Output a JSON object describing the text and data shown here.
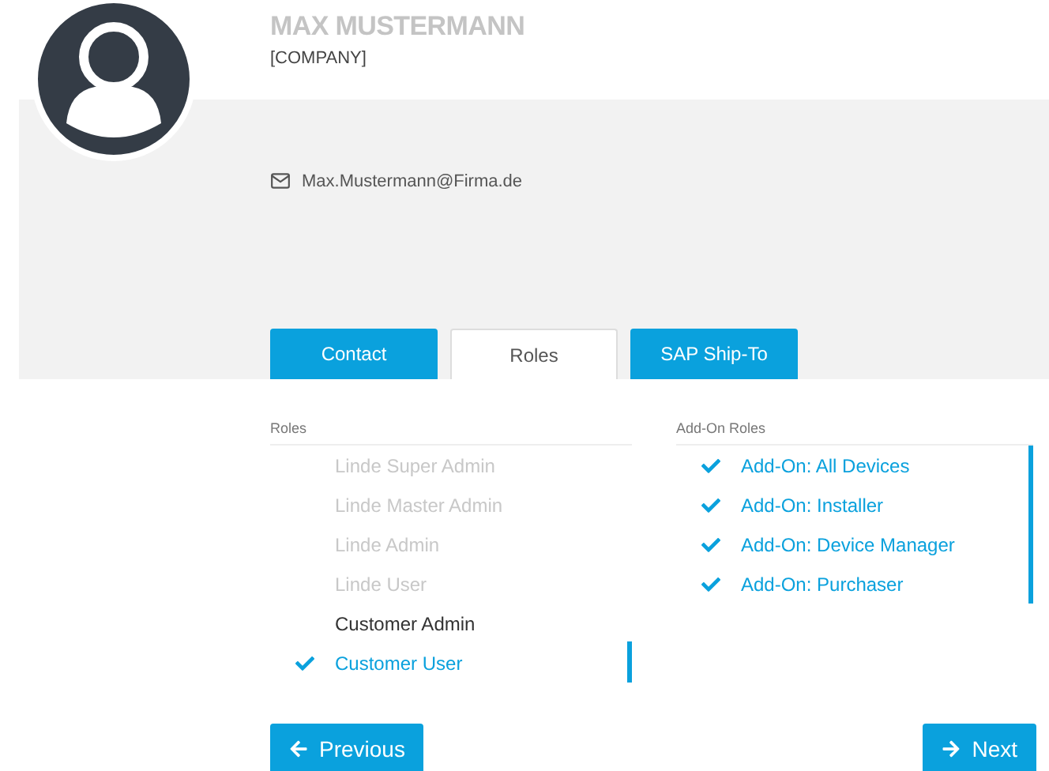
{
  "profile": {
    "name": "MAX MUSTERMANN",
    "company": "[COMPANY]",
    "email": "Max.Mustermann@Firma.de"
  },
  "tabs": [
    {
      "label": "Contact",
      "selected": false
    },
    {
      "label": "Roles",
      "selected": true
    },
    {
      "label": "SAP Ship-To",
      "selected": false
    }
  ],
  "roles": {
    "heading": "Roles",
    "items": [
      {
        "label": "Linde Super Admin",
        "disabled": true,
        "selected": false
      },
      {
        "label": "Linde Master Admin",
        "disabled": true,
        "selected": false
      },
      {
        "label": "Linde Admin",
        "disabled": true,
        "selected": false
      },
      {
        "label": "Linde User",
        "disabled": true,
        "selected": false
      },
      {
        "label": "Customer Admin",
        "disabled": false,
        "selected": false
      },
      {
        "label": "Customer User",
        "disabled": false,
        "selected": true
      }
    ]
  },
  "addon_roles": {
    "heading": "Add-On Roles",
    "items": [
      {
        "label": "Add-On: All Devices",
        "disabled": false,
        "selected": true
      },
      {
        "label": "Add-On: Installer",
        "disabled": false,
        "selected": true
      },
      {
        "label": "Add-On: Device Manager",
        "disabled": false,
        "selected": true
      },
      {
        "label": "Add-On: Purchaser",
        "disabled": false,
        "selected": true
      }
    ]
  },
  "buttons": [
    {
      "label": "Previous",
      "kind": "back"
    },
    {
      "label": "Next",
      "kind": "forward"
    }
  ]
}
